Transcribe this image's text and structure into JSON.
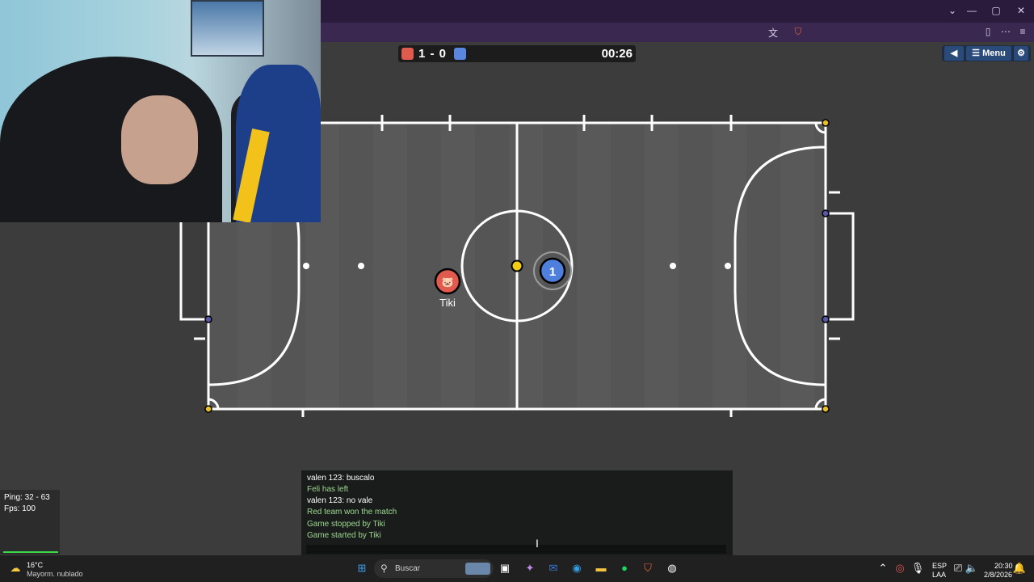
{
  "window": {
    "minimize": "—",
    "maximize": "▢",
    "close": "✕",
    "dropdown": "⌄"
  },
  "scoreboard": {
    "score": "1 - 0",
    "timer": "00:26",
    "red_color": "#e05a4e",
    "blue_color": "#5b86e0"
  },
  "menu": {
    "back_glyph": "◀",
    "menu_label": "Menu",
    "settings_glyph": "⚙"
  },
  "players": [
    {
      "team": "red",
      "name": "Tiki",
      "avatar": "🐷",
      "color": "#e05a4e"
    },
    {
      "team": "blue",
      "name": "",
      "avatar": "1",
      "color": "#4f7fdc"
    }
  ],
  "ball_color": "#f2cc11",
  "stats": {
    "ping": "Ping: 32 - 63",
    "fps": "Fps: 100"
  },
  "chat": {
    "lines": [
      {
        "text": "valen 123: buscalo",
        "kind": "msg"
      },
      {
        "text": "Feli has left",
        "kind": "sys"
      },
      {
        "text": "valen 123: no vale",
        "kind": "msg"
      },
      {
        "text": "Red team won the match",
        "kind": "sys"
      },
      {
        "text": "Game stopped by Tiki",
        "kind": "sys"
      },
      {
        "text": "Game started by Tiki",
        "kind": "sys"
      }
    ],
    "input_value": ""
  },
  "taskbar": {
    "weather_temp": "16°C",
    "weather_desc": "Mayorm. nublado",
    "search_placeholder": "Buscar",
    "lang_top": "ESP",
    "lang_bottom": "LAA",
    "time": "20:30",
    "date": "2/8/2026"
  }
}
